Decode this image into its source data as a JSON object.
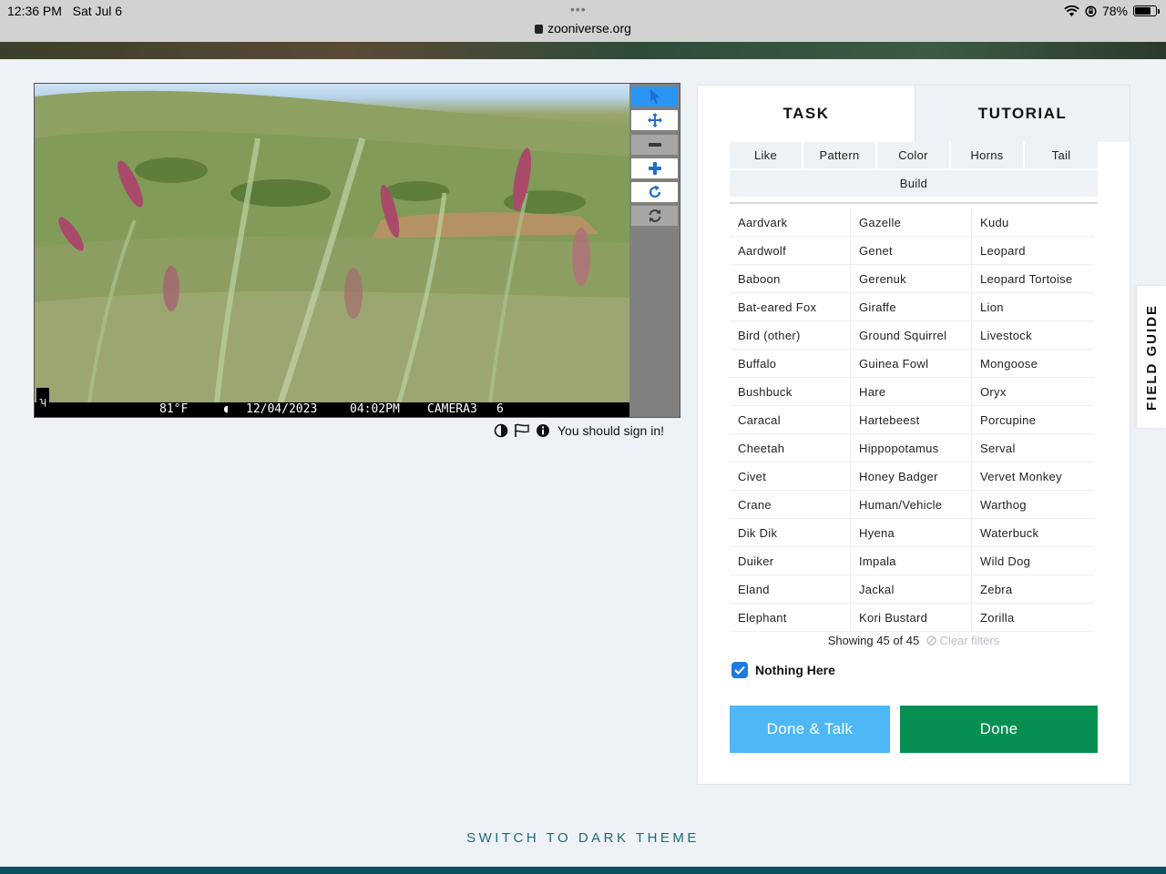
{
  "status_bar": {
    "time": "12:36 PM",
    "date": "Sat Jul 6",
    "url": "zooniverse.org",
    "battery": "78%",
    "battery_level": 0.78
  },
  "viewer": {
    "info_strip": {
      "temperature": "81°F",
      "date": "12/04/2023",
      "time": "04:02PM",
      "camera": "CAMERA3",
      "frame": "6"
    },
    "tools": [
      {
        "name": "pointer-icon",
        "state": "active"
      },
      {
        "name": "move-icon",
        "state": "normal"
      },
      {
        "name": "zoom-out-icon",
        "state": "disabled"
      },
      {
        "name": "zoom-in-icon",
        "state": "normal"
      },
      {
        "name": "rotate-icon",
        "state": "normal"
      },
      {
        "name": "reset-icon",
        "state": "disabled"
      }
    ],
    "sign_in_text": "You should sign in!"
  },
  "panel": {
    "tabs": [
      {
        "label": "TASK",
        "active": true
      },
      {
        "label": "TUTORIAL",
        "active": false
      }
    ],
    "filters": [
      "Like",
      "Pattern",
      "Color",
      "Horns",
      "Tail",
      "Build"
    ],
    "species_columns": [
      [
        "Aardvark",
        "Aardwolf",
        "Baboon",
        "Bat-eared Fox",
        "Bird (other)",
        "Buffalo",
        "Bushbuck",
        "Caracal",
        "Cheetah",
        "Civet",
        "Crane",
        "Dik Dik",
        "Duiker",
        "Eland",
        "Elephant"
      ],
      [
        "Gazelle",
        "Genet",
        "Gerenuk",
        "Giraffe",
        "Ground Squirrel",
        "Guinea Fowl",
        "Hare",
        "Hartebeest",
        "Hippopotamus",
        "Honey Badger",
        "Human/Vehicle",
        "Hyena",
        "Impala",
        "Jackal",
        "Kori Bustard"
      ],
      [
        "Kudu",
        "Leopard",
        "Leopard Tortoise",
        "Lion",
        "Livestock",
        "Mongoose",
        "Oryx",
        "Porcupine",
        "Serval",
        "Vervet Monkey",
        "Warthog",
        "Waterbuck",
        "Wild Dog",
        "Zebra",
        "Zorilla"
      ]
    ],
    "showing": "Showing 45 of 45",
    "clear_filters": "Clear filters",
    "nothing_here": "Nothing Here",
    "done_talk": "Done & Talk",
    "done": "Done"
  },
  "field_guide": "FIELD GUIDE",
  "dark_theme_link": "SWITCH TO DARK THEME"
}
